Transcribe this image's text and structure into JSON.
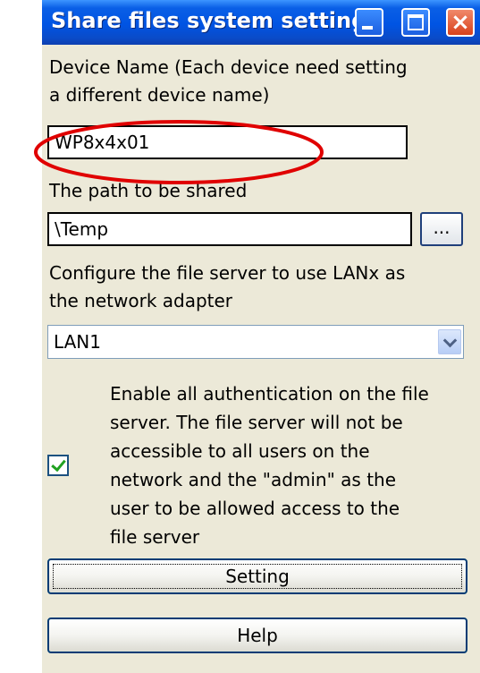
{
  "window": {
    "title": "Share files system setting",
    "title_buttons": {
      "minimize": "minimize",
      "maximize": "maximize",
      "close": "×"
    }
  },
  "device_name": {
    "label_line1": "Device Name (Each device need setting",
    "label_line2": "a different device name)",
    "value": "WP8x4x01"
  },
  "share_path": {
    "label": "The path to be shared",
    "value": "\\Temp",
    "browse_label": "..."
  },
  "adapter": {
    "label_line1": "Configure the file server to use LANx as",
    "label_line2": "the network adapter",
    "selected": "LAN1"
  },
  "authentication": {
    "checked": true,
    "label": "Enable all authentication on the file\nserver. The file server will not be\naccessible to all users on the\nnetwork and the \"admin\" as the\nuser to be allowed access to the\nfile server"
  },
  "buttons": {
    "setting": "Setting",
    "help": "Help"
  },
  "colors": {
    "titlebar": "#0054e3",
    "window_bg": "#ece9d8",
    "annotation": "#e00000",
    "checkmark": "#21a121"
  }
}
